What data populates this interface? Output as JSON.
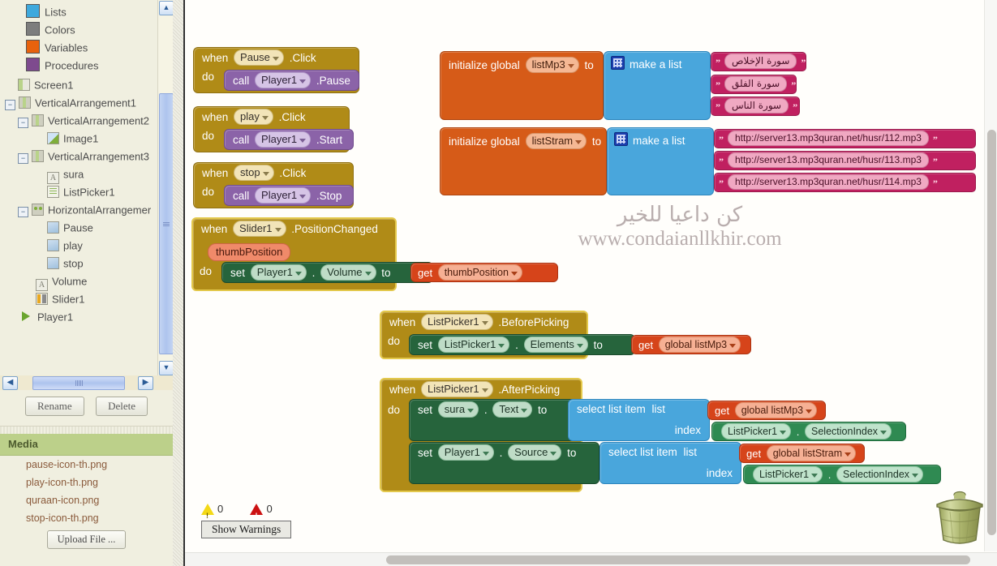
{
  "sidebar": {
    "palette_items": [
      {
        "label": "Lists",
        "color": "#3ea9dd"
      },
      {
        "label": "Colors",
        "color": "#7d7d7d"
      },
      {
        "label": "Variables",
        "color": "#e8620d"
      },
      {
        "label": "Procedures",
        "color": "#7e4a8e"
      }
    ],
    "tree": [
      {
        "label": "Screen1",
        "indent": 1,
        "toggle": "",
        "icon": "screen"
      },
      {
        "label": "VerticalArrangement1",
        "indent": 1,
        "toggle": "-",
        "icon": "va"
      },
      {
        "label": "VerticalArrangement2",
        "indent": 2,
        "toggle": "-",
        "icon": "va"
      },
      {
        "label": "Image1",
        "indent": 3,
        "toggle": "",
        "icon": "img"
      },
      {
        "label": "VerticalArrangement3",
        "indent": 2,
        "toggle": "-",
        "icon": "va"
      },
      {
        "label": "sura",
        "indent": 3,
        "toggle": "",
        "icon": "txt"
      },
      {
        "label": "ListPicker1",
        "indent": 3,
        "toggle": "",
        "icon": "lp"
      },
      {
        "label": "HorizontalArrangemer",
        "indent": 2,
        "toggle": "-",
        "icon": "ha"
      },
      {
        "label": "Pause",
        "indent": 3,
        "toggle": "",
        "icon": "btn"
      },
      {
        "label": "play",
        "indent": 3,
        "toggle": "",
        "icon": "btn"
      },
      {
        "label": "stop",
        "indent": 3,
        "toggle": "",
        "icon": "btn"
      },
      {
        "label": "Volume",
        "indent": 2,
        "toggle": "",
        "icon": "txt"
      },
      {
        "label": "Slider1",
        "indent": 2,
        "toggle": "",
        "icon": "slider"
      },
      {
        "label": "Player1",
        "indent": 1,
        "toggle": "",
        "icon": "player"
      }
    ],
    "rename_label": "Rename",
    "delete_label": "Delete",
    "media": {
      "header": "Media",
      "files": [
        "pause-icon-th.png",
        "play-icon-th.png",
        "quraan-icon.png",
        "stop-icon-th.png"
      ],
      "upload_label": "Upload File ..."
    },
    "scroll_left_icon": "chevron-left-icon",
    "scroll_right_icon": "chevron-right-icon",
    "scroll_up_icon": "chevron-up-icon",
    "scroll_down_icon": "chevron-down-icon"
  },
  "watermark": {
    "arabic": "كن داعيا للخير",
    "url": "www.condaianllkhir.com"
  },
  "blocks": {
    "event_pause": {
      "when": "when",
      "component": "Pause",
      "event": ".Click",
      "do": "do",
      "call": "call",
      "target": "Player1",
      "method": ".Pause"
    },
    "event_play": {
      "when": "when",
      "component": "play",
      "event": ".Click",
      "do": "do",
      "call": "call",
      "target": "Player1",
      "method": ".Start"
    },
    "event_stop": {
      "when": "when",
      "component": "stop",
      "event": ".Click",
      "do": "do",
      "call": "call",
      "target": "Player1",
      "method": ".Stop"
    },
    "event_slider": {
      "when": "when",
      "component": "Slider1",
      "event": ".PositionChanged",
      "param": "thumbPosition",
      "do": "do",
      "set": "set",
      "target": "Player1",
      "dot": ".",
      "property": "Volume",
      "to": "to",
      "get": "get",
      "get_value": "thumbPosition"
    },
    "init_listmp3": {
      "label": "initialize global",
      "name": "listMp3",
      "to": "to",
      "make_list": "make a list",
      "items": [
        "سورة الإخلاص",
        "سورة الفلق",
        "سورة الناس"
      ]
    },
    "init_liststram": {
      "label": "initialize global",
      "name": "listStram",
      "to": "to",
      "make_list": "make a list",
      "items": [
        "http://server13.mp3quran.net/husr/112.mp3",
        "http://server13.mp3quran.net/husr/113.mp3",
        "http://server13.mp3quran.net/husr/114.mp3"
      ]
    },
    "event_beforepicking": {
      "when": "when",
      "component": "ListPicker1",
      "event": ".BeforePicking",
      "do": "do",
      "set": "set",
      "target": "ListPicker1",
      "dot": ".",
      "property": "Elements",
      "to": "to",
      "get": "get",
      "get_value": "global listMp3"
    },
    "event_afterpicking": {
      "when": "when",
      "component": "ListPicker1",
      "event": ".AfterPicking",
      "do": "do",
      "row1": {
        "set": "set",
        "target": "sura",
        "dot": ".",
        "property": "Text",
        "to": "to",
        "select": "select list item",
        "list_label": "list",
        "get": "get",
        "get_value": "global listMp3",
        "index_label": "index",
        "index_component": "ListPicker1",
        "index_dot": ".",
        "index_property": "SelectionIndex"
      },
      "row2": {
        "set": "set",
        "target": "Player1",
        "dot": ".",
        "property": "Source",
        "to": "to",
        "select": "select list item",
        "list_label": "list",
        "get": "get",
        "get_value": "global listStram",
        "index_label": "index",
        "index_component": "ListPicker1",
        "index_dot": ".",
        "index_property": "SelectionIndex"
      }
    }
  },
  "warnings": {
    "warning_count": "0",
    "error_count": "0",
    "show_warnings_label": "Show Warnings",
    "warning_icon": "warning-triangle-icon",
    "error_icon": "error-triangle-icon"
  },
  "trash": {
    "icon": "trash-can-icon"
  },
  "colors": {
    "event_block": "#b08b17",
    "method_block": "#8b63a8",
    "setter_block": "#26643c",
    "component_getter": "#2f8a52",
    "variable_block": "#d65b18",
    "getter_block": "#d6441a",
    "list_block": "#49a6dc",
    "text_block": "#c02060",
    "panel_bg": "#f0efe0",
    "media_header": "#bcd08a"
  }
}
